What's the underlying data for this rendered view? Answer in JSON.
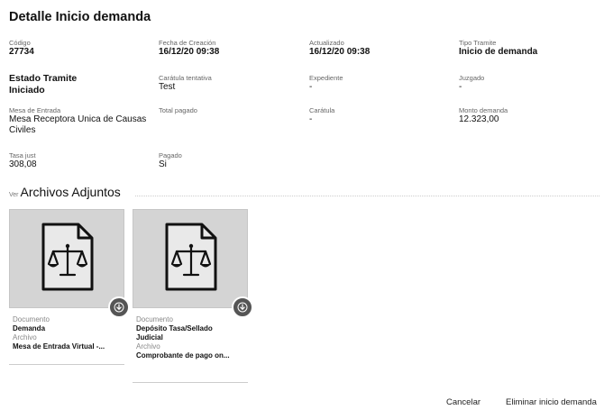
{
  "page": {
    "title": "Detalle Inicio demanda"
  },
  "fields": {
    "codigo": {
      "label": "Código",
      "value": "27734"
    },
    "fecha_creacion": {
      "label": "Fecha de Creación",
      "value": "16/12/20 09:38"
    },
    "actualizado": {
      "label": "Actualizado",
      "value": "16/12/20 09:38"
    },
    "tipo_tramite": {
      "label": "Tipo Tramite",
      "value": "Inicio de demanda"
    },
    "estado_tramite": {
      "label": "Estado Tramite",
      "value": "Iniciado"
    },
    "caratula_tentativa": {
      "label": "Carátula tentativa",
      "value": "Test"
    },
    "expediente": {
      "label": "Expediente",
      "value": "-"
    },
    "juzgado": {
      "label": "Juzgado",
      "value": "-"
    },
    "mesa_entrada": {
      "label": "Mesa de Entrada",
      "value_line1": "Mesa Receptora Unica de Causas",
      "value_line2": "Civiles"
    },
    "total_pagado": {
      "label": "Total pagado",
      "value": ""
    },
    "caratula": {
      "label": "Carátula",
      "value": "-"
    },
    "monto_demanda": {
      "label": "Monto demanda",
      "value": "12.323,00"
    },
    "tasa_just": {
      "label": "Tasa just",
      "value": "308,08"
    },
    "pagado": {
      "label": "Pagado",
      "value": "Si"
    }
  },
  "attachments": {
    "prefix": "Ver",
    "title": "Archivos Adjuntos",
    "items": [
      {
        "doc_label": "Documento",
        "doc_value": "Demanda",
        "file_label": "Archivo",
        "file_value": "Mesa de Entrada Virtual -..."
      },
      {
        "doc_label": "Documento",
        "doc_value_line1": "Depósito Tasa/Sellado",
        "doc_value_line2": "Judicial",
        "file_label": "Archivo",
        "file_value": "Comprobante de pago on..."
      }
    ]
  },
  "actions": {
    "cancel": "Cancelar",
    "delete": "Eliminar inicio demanda"
  },
  "icons": {
    "document": "document-scales-icon",
    "download": "download-icon"
  },
  "colors": {
    "thumb_bg": "#d4d4d4",
    "download_bg": "#555555"
  }
}
